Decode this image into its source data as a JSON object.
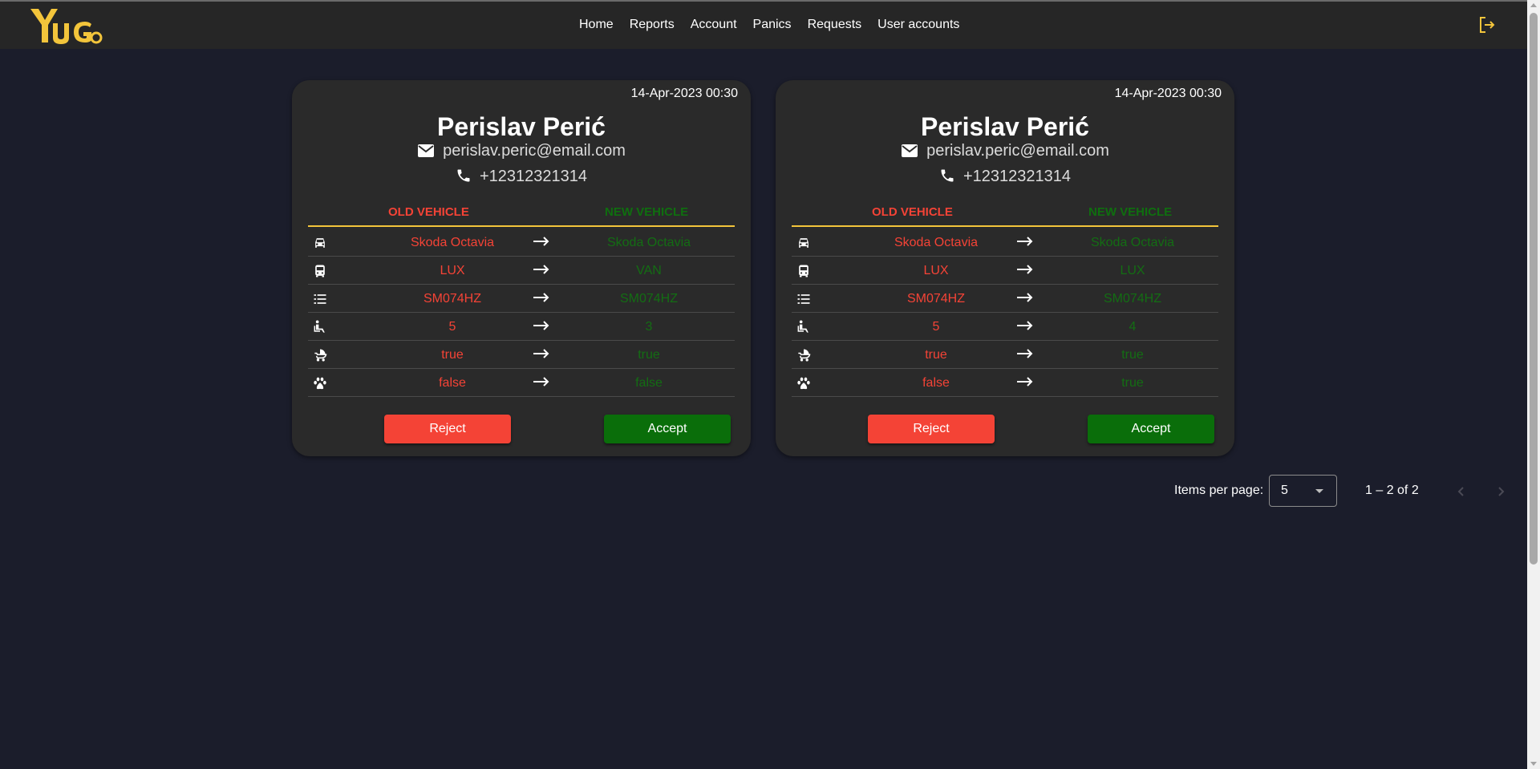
{
  "app": {
    "logo_text": "YuGo",
    "nav": [
      "Home",
      "Reports",
      "Account",
      "Panics",
      "Requests",
      "User accounts"
    ],
    "logout_icon": "logout-icon",
    "accent_color": "#f3c53b"
  },
  "headers": {
    "old": "OLD VEHICLE",
    "new": "NEW VEHICLE"
  },
  "requests": [
    {
      "date": "14-Apr-2023 00:30",
      "name": "Perislav Perić",
      "email": "perislav.peric@email.com",
      "phone": "+12312321314",
      "rows": [
        {
          "icon": "car-icon",
          "old": "Skoda Octavia",
          "new": "Skoda Octavia"
        },
        {
          "icon": "bus-icon",
          "old": "LUX",
          "new": "VAN"
        },
        {
          "icon": "list-icon",
          "old": "SM074HZ",
          "new": "SM074HZ"
        },
        {
          "icon": "seat-icon",
          "old": "5",
          "new": "3"
        },
        {
          "icon": "stroller-icon",
          "old": "true",
          "new": "true"
        },
        {
          "icon": "paw-icon",
          "old": "false",
          "new": "false"
        }
      ],
      "reject_label": "Reject",
      "accept_label": "Accept"
    },
    {
      "date": "14-Apr-2023 00:30",
      "name": "Perislav Perić",
      "email": "perislav.peric@email.com",
      "phone": "+12312321314",
      "rows": [
        {
          "icon": "car-icon",
          "old": "Skoda Octavia",
          "new": "Skoda Octavia"
        },
        {
          "icon": "bus-icon",
          "old": "LUX",
          "new": "LUX"
        },
        {
          "icon": "list-icon",
          "old": "SM074HZ",
          "new": "SM074HZ"
        },
        {
          "icon": "seat-icon",
          "old": "5",
          "new": "4"
        },
        {
          "icon": "stroller-icon",
          "old": "true",
          "new": "true"
        },
        {
          "icon": "paw-icon",
          "old": "false",
          "new": "true"
        }
      ],
      "reject_label": "Reject",
      "accept_label": "Accept"
    }
  ],
  "paginator": {
    "items_per_page_label": "Items per page:",
    "items_per_page": "5",
    "range": "1 – 2 of 2"
  },
  "colors": {
    "old": "#f44336",
    "new": "#136d13",
    "reject": "#f44336",
    "accept": "#0a6e0a"
  }
}
